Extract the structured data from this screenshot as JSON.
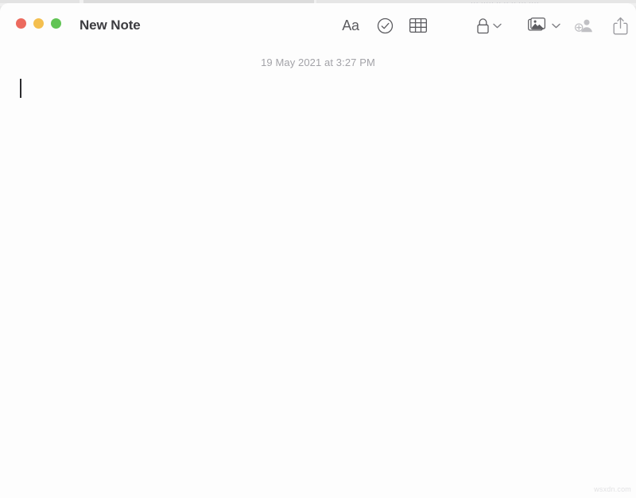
{
  "window": {
    "title": "New Note",
    "traffic_lights": [
      {
        "name": "close",
        "color": "#ec6a5e"
      },
      {
        "name": "minimize",
        "color": "#f4bf4f"
      },
      {
        "name": "maximize",
        "color": "#61c454"
      }
    ]
  },
  "toolbar": {
    "format_label": "Aa",
    "items": [
      {
        "name": "format",
        "label": "Aa",
        "icon": "format-aa-icon"
      },
      {
        "name": "checklist",
        "label": "",
        "icon": "checklist-circle-check-icon"
      },
      {
        "name": "table",
        "label": "",
        "icon": "table-grid-icon"
      },
      {
        "name": "lock",
        "label": "",
        "icon": "lock-icon",
        "has_chevron": true
      },
      {
        "name": "media",
        "label": "",
        "icon": "media-photos-icon",
        "has_chevron": true
      },
      {
        "name": "collaborate",
        "label": "",
        "icon": "add-person-icon",
        "disabled": true
      },
      {
        "name": "share",
        "label": "",
        "icon": "share-up-arrow-icon"
      }
    ]
  },
  "note": {
    "date": "19 May 2021 at 3:27 PM",
    "body_text": "",
    "caret_visible": true
  },
  "watermark": {
    "text": "wsxdn.com"
  },
  "ghost": {
    "text": "··· ····· ·· ·· ·· ··· ····"
  },
  "colors": {
    "window_bg": "#fdfdfd",
    "desktop_bg": "#e8e8e8",
    "title_text": "#3c3c40",
    "icon": "#5c5c60",
    "icon_disabled": "#c0c0c4",
    "date_text": "#a3a3a8"
  }
}
